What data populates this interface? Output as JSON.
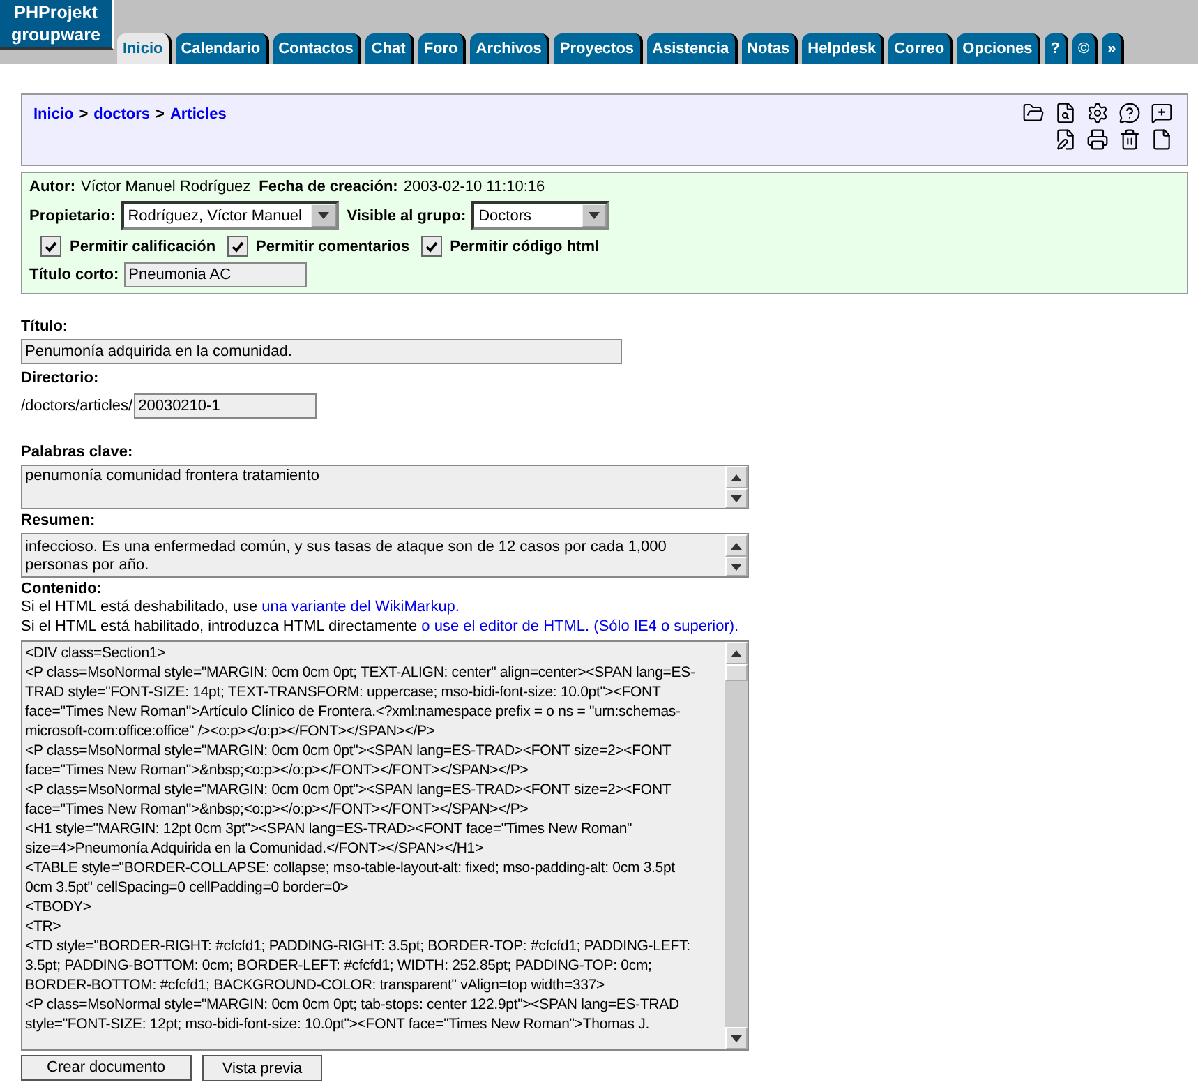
{
  "logo": {
    "line1": "PHProjekt",
    "line2": "groupware"
  },
  "tabs": [
    {
      "label": "Inicio",
      "selected": true
    },
    {
      "label": "Calendario",
      "selected": false
    },
    {
      "label": "Contactos",
      "selected": false
    },
    {
      "label": "Chat",
      "selected": false
    },
    {
      "label": "Foro",
      "selected": false
    },
    {
      "label": "Archivos",
      "selected": false
    },
    {
      "label": "Proyectos",
      "selected": false
    },
    {
      "label": "Asistencia",
      "selected": false
    },
    {
      "label": "Notas",
      "selected": false
    },
    {
      "label": "Helpdesk",
      "selected": false
    },
    {
      "label": "Correo",
      "selected": false
    },
    {
      "label": "Opciones",
      "selected": false
    },
    {
      "label": "?",
      "selected": false
    },
    {
      "label": "©",
      "selected": false
    },
    {
      "label": "»",
      "selected": false
    }
  ],
  "breadcrumb": [
    {
      "label": "Inicio"
    },
    {
      "label": "doctors"
    },
    {
      "label": "Articles"
    }
  ],
  "breadcrumb_separator": ">",
  "toolbar": [
    {
      "kind": "folder"
    },
    {
      "kind": "search"
    },
    {
      "kind": "gear"
    },
    {
      "kind": "question"
    },
    {
      "kind": "pencil-bubble"
    },
    {
      "kind": "edit"
    },
    {
      "kind": "print"
    },
    {
      "kind": "trash"
    },
    {
      "kind": "page"
    }
  ],
  "meta": {
    "author_label": "Autor:",
    "author": "Víctor Manuel Rodríguez",
    "date_label": "Fecha de creación:",
    "date": "2003-02-10 11:10:16",
    "owner_label": "Propietario:",
    "owner": "Rodríguez, Víctor Manuel",
    "group_label": "Visible al grupo:",
    "group": "Doctors",
    "checkboxes": [
      {
        "label": "Permitir calificación",
        "checked": true
      },
      {
        "label": "Permitir comentarios",
        "checked": true
      },
      {
        "label": "Permitir código html",
        "checked": true
      }
    ],
    "short_title_label": "Título corto:",
    "short_title": "Pneumonia AC"
  },
  "title_label": "Título:",
  "title": "Penumonía adquirida en la comunidad.",
  "directory_label": "Directorio:",
  "directory_prefix": "/doctors/articles/",
  "directory": "20030210-1",
  "keywords_label": "Palabras clave:",
  "keywords": "penumonía comunidad frontera tratamiento",
  "summary_label": "Resumen:",
  "summary": "infeccioso. Es una enfermedad común, y sus tasas de ataque son de 12 casos por cada 1,000 personas por año.",
  "content_label": "Contenido:",
  "hint1": {
    "text": "Si el HTML está deshabilitado, use",
    "link": "una variante del WikiMarkup."
  },
  "hint2": {
    "text": "Si el HTML está habilitado, introduzca HTML directamente",
    "link": "o use el editor de HTML.",
    "note": "(Sólo IE4 o superior)."
  },
  "content_lines": [
    "<DIV class=Section1>",
    "<P class=MsoNormal style=\"MARGIN: 0cm 0cm 0pt; TEXT-ALIGN: center\" align=center><SPAN lang=ES-",
    "TRAD style=\"FONT-SIZE: 14pt; TEXT-TRANSFORM: uppercase; mso-bidi-font-size: 10.0pt\"><FONT",
    "face=\"Times New Roman\">Artículo Clínico de Frontera.<?xml:namespace prefix = o ns = \"urn:schemas-",
    "microsoft-com:office:office\" /><o:p></o:p></FONT></SPAN></P>",
    "<P class=MsoNormal style=\"MARGIN: 0cm 0cm 0pt\"><SPAN lang=ES-TRAD><FONT size=2><FONT",
    "face=\"Times New Roman\">&nbsp;<o:p></o:p></FONT></FONT></SPAN></P>",
    "<P class=MsoNormal style=\"MARGIN: 0cm 0cm 0pt\"><SPAN lang=ES-TRAD><FONT size=2><FONT",
    "face=\"Times New Roman\">&nbsp;<o:p></o:p></FONT></FONT></SPAN></P>",
    "<H1 style=\"MARGIN: 12pt 0cm 3pt\"><SPAN lang=ES-TRAD><FONT face=\"Times New Roman\"",
    "size=4>Pneumonía Adquirida en la Comunidad.</FONT></SPAN></H1>",
    "<TABLE style=\"BORDER-COLLAPSE: collapse; mso-table-layout-alt: fixed; mso-padding-alt: 0cm 3.5pt",
    "0cm 3.5pt\" cellSpacing=0 cellPadding=0 border=0>",
    "<TBODY>",
    "<TR>",
    "<TD style=\"BORDER-RIGHT: #cfcfd1; PADDING-RIGHT: 3.5pt; BORDER-TOP: #cfcfd1; PADDING-LEFT:",
    "3.5pt; PADDING-BOTTOM: 0cm; BORDER-LEFT: #cfcfd1; WIDTH: 252.85pt; PADDING-TOP: 0cm;",
    "BORDER-BOTTOM: #cfcfd1; BACKGROUND-COLOR: transparent\" vAlign=top width=337>",
    "<P class=MsoNormal style=\"MARGIN: 0cm 0cm 0pt; tab-stops: center 122.9pt\"><SPAN lang=ES-TRAD",
    "style=\"FONT-SIZE: 12pt; mso-bidi-font-size: 10.0pt\"><FONT face=\"Times New Roman\">Thomas J."
  ],
  "buttons": [
    {
      "label": "Crear documento",
      "kind": "primary"
    },
    {
      "label": "Vista previa",
      "kind": "secondary"
    }
  ]
}
